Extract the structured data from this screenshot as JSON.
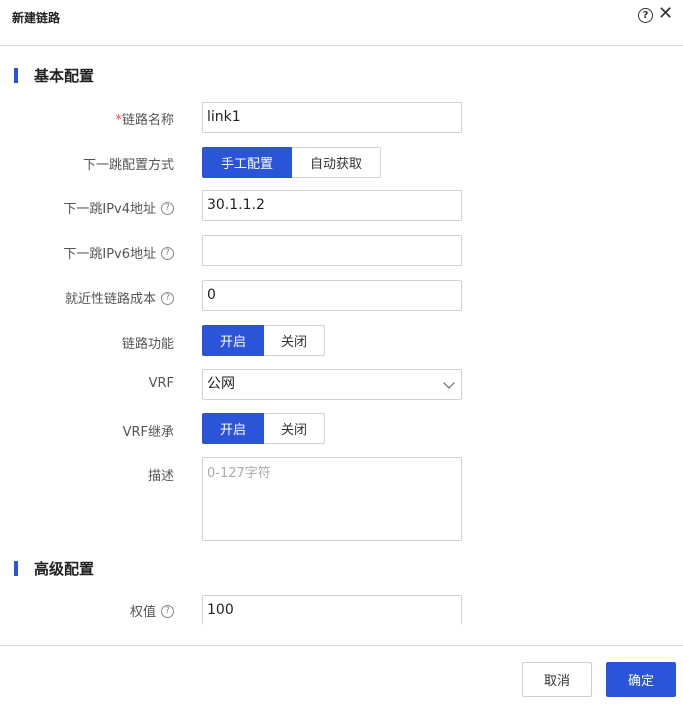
{
  "dialog": {
    "title": "新建链路",
    "help_icon": "question-circle-icon",
    "close_icon": "close-icon",
    "close_glyph": "✕",
    "help_glyph": "?"
  },
  "basic": {
    "section_title": "基本配置",
    "link_name": {
      "required_mark": "*",
      "label": "链路名称",
      "value": "link1"
    },
    "next_hop_mode": {
      "label": "下一跳配置方式",
      "options": [
        "手工配置",
        "自动获取"
      ],
      "selected": "手工配置"
    },
    "next_hop_ipv4": {
      "label": "下一跳IPv4地址",
      "value": "30.1.1.2"
    },
    "next_hop_ipv6": {
      "label": "下一跳IPv6地址",
      "value": ""
    },
    "proximity_cost": {
      "label": "就近性链路成本",
      "value": "0"
    },
    "link_function": {
      "label": "链路功能",
      "options": [
        "开启",
        "关闭"
      ],
      "selected": "开启"
    },
    "vrf": {
      "label": "VRF",
      "value": "公网"
    },
    "vrf_inherit": {
      "label": "VRF继承",
      "options": [
        "开启",
        "关闭"
      ],
      "selected": "开启"
    },
    "description": {
      "label": "描述",
      "placeholder": "0-127字符"
    }
  },
  "advanced": {
    "section_title": "高级配置",
    "weight": {
      "label": "权值",
      "value": "100"
    }
  },
  "footer": {
    "cancel": "取消",
    "confirm": "确定"
  },
  "colors": {
    "accent": "#2b55d9",
    "required": "#e5484d"
  }
}
